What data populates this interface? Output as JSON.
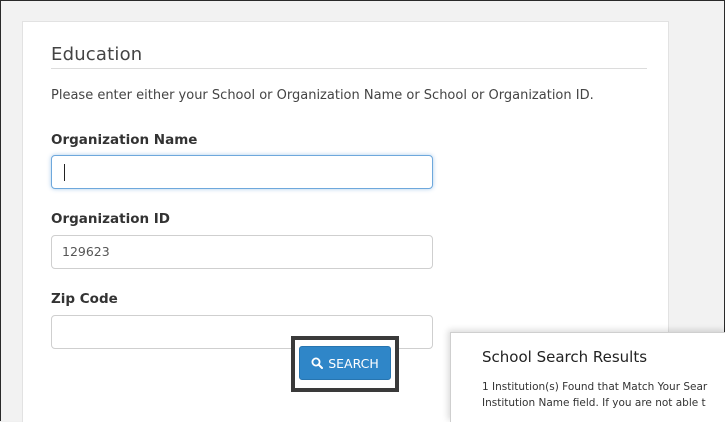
{
  "section": {
    "title": "Education",
    "instructions": "Please enter either your School or Organization Name or School or Organization ID."
  },
  "fields": {
    "org_name": {
      "label": "Organization Name",
      "value": ""
    },
    "org_id": {
      "label": "Organization ID",
      "value": "129623"
    },
    "zip": {
      "label": "Zip Code",
      "value": ""
    }
  },
  "search_button": {
    "label": "SEARCH",
    "icon": "search-icon",
    "color": "#2f86c8"
  },
  "results": {
    "title": "School Search Results",
    "line1": "1 Institution(s) Found that Match Your Sear",
    "line2": "Institution Name field. If you are not able t"
  }
}
